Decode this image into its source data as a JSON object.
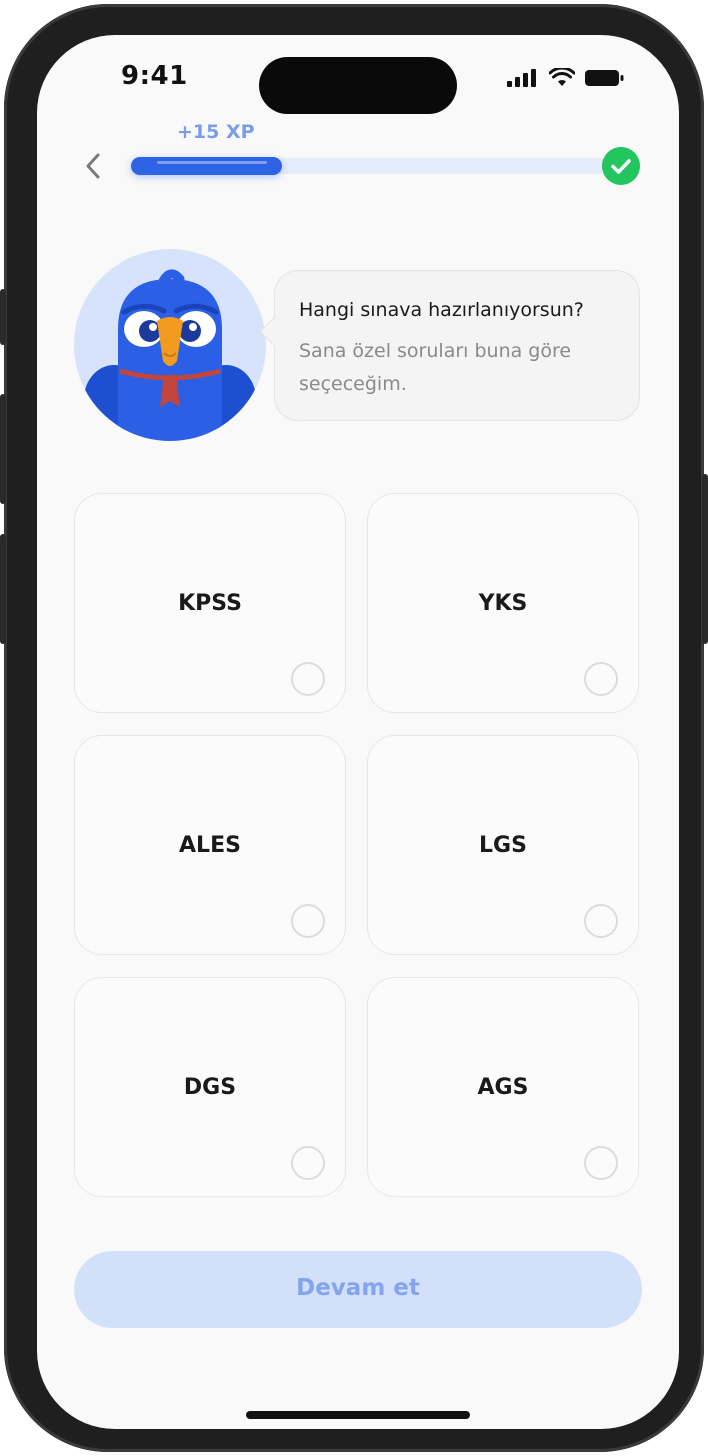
{
  "status_bar": {
    "time": "9:41"
  },
  "progress": {
    "xp_label": "+15 XP",
    "value": 0.31,
    "completed": true
  },
  "prompt": {
    "title": "Hangi sınava hazırlanıyorsun?",
    "subtitle": "Sana özel soruları buna göre seçeceğim."
  },
  "options": [
    {
      "label": "KPSS",
      "selected": false
    },
    {
      "label": "YKS",
      "selected": false
    },
    {
      "label": "ALES",
      "selected": false
    },
    {
      "label": "LGS",
      "selected": false
    },
    {
      "label": "DGS",
      "selected": false
    },
    {
      "label": "AGS",
      "selected": false
    }
  ],
  "continue_button": {
    "label": "Devam et",
    "enabled": false
  },
  "colors": {
    "accent": "#2e63e6",
    "success": "#22c55e",
    "button_disabled_bg": "#d2e0fa",
    "button_disabled_text": "#83a4ef"
  }
}
